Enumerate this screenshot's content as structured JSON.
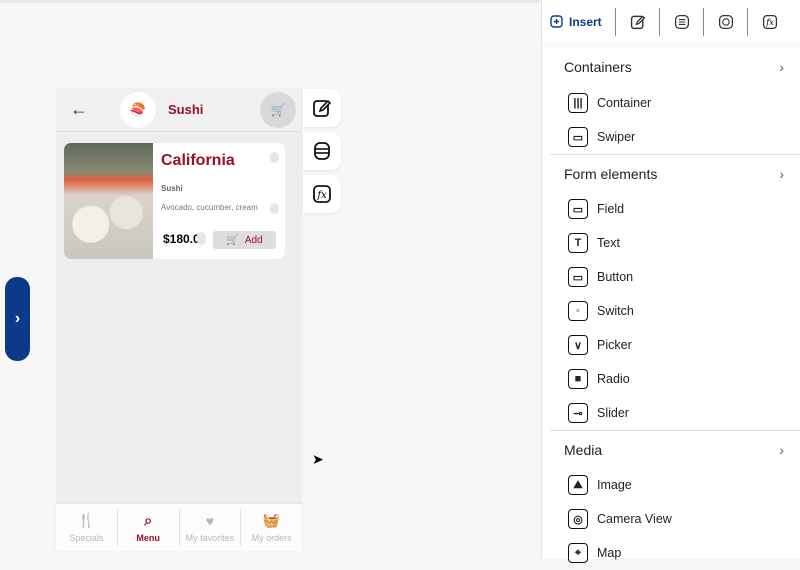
{
  "phone": {
    "title": "Sushi",
    "card": {
      "name": "California",
      "category": "Sushi",
      "description": "Avocado, cucumber, cream",
      "price": "$180.00",
      "add_label": "Add"
    },
    "tabs": [
      {
        "label": "Specials",
        "icon": "fork-knife-icon",
        "glyph": "🍴"
      },
      {
        "label": "Menu",
        "icon": "search-icon",
        "glyph": "⌕"
      },
      {
        "label": "My favorites",
        "icon": "heart-icon",
        "glyph": "♥"
      },
      {
        "label": "My orders",
        "icon": "basket-icon",
        "glyph": "🧺"
      }
    ]
  },
  "panel": {
    "insert_label": "Insert",
    "sections": [
      {
        "title": "Containers",
        "items": [
          {
            "label": "Container",
            "glyph": "|||"
          },
          {
            "label": "Swiper",
            "glyph": "▭"
          }
        ]
      },
      {
        "title": "Form elements",
        "items": [
          {
            "label": "Field",
            "glyph": "▭"
          },
          {
            "label": "Text",
            "glyph": "T"
          },
          {
            "label": "Button",
            "glyph": "▭"
          },
          {
            "label": "Switch",
            "glyph": "◦"
          },
          {
            "label": "Picker",
            "glyph": "∨"
          },
          {
            "label": "Radio",
            "glyph": "■"
          },
          {
            "label": "Slider",
            "glyph": "⊸"
          }
        ]
      },
      {
        "title": "Media",
        "items": [
          {
            "label": "Image",
            "glyph": "⛰"
          },
          {
            "label": "Camera View",
            "glyph": "◎"
          },
          {
            "label": "Map",
            "glyph": "⌖"
          }
        ]
      }
    ]
  }
}
